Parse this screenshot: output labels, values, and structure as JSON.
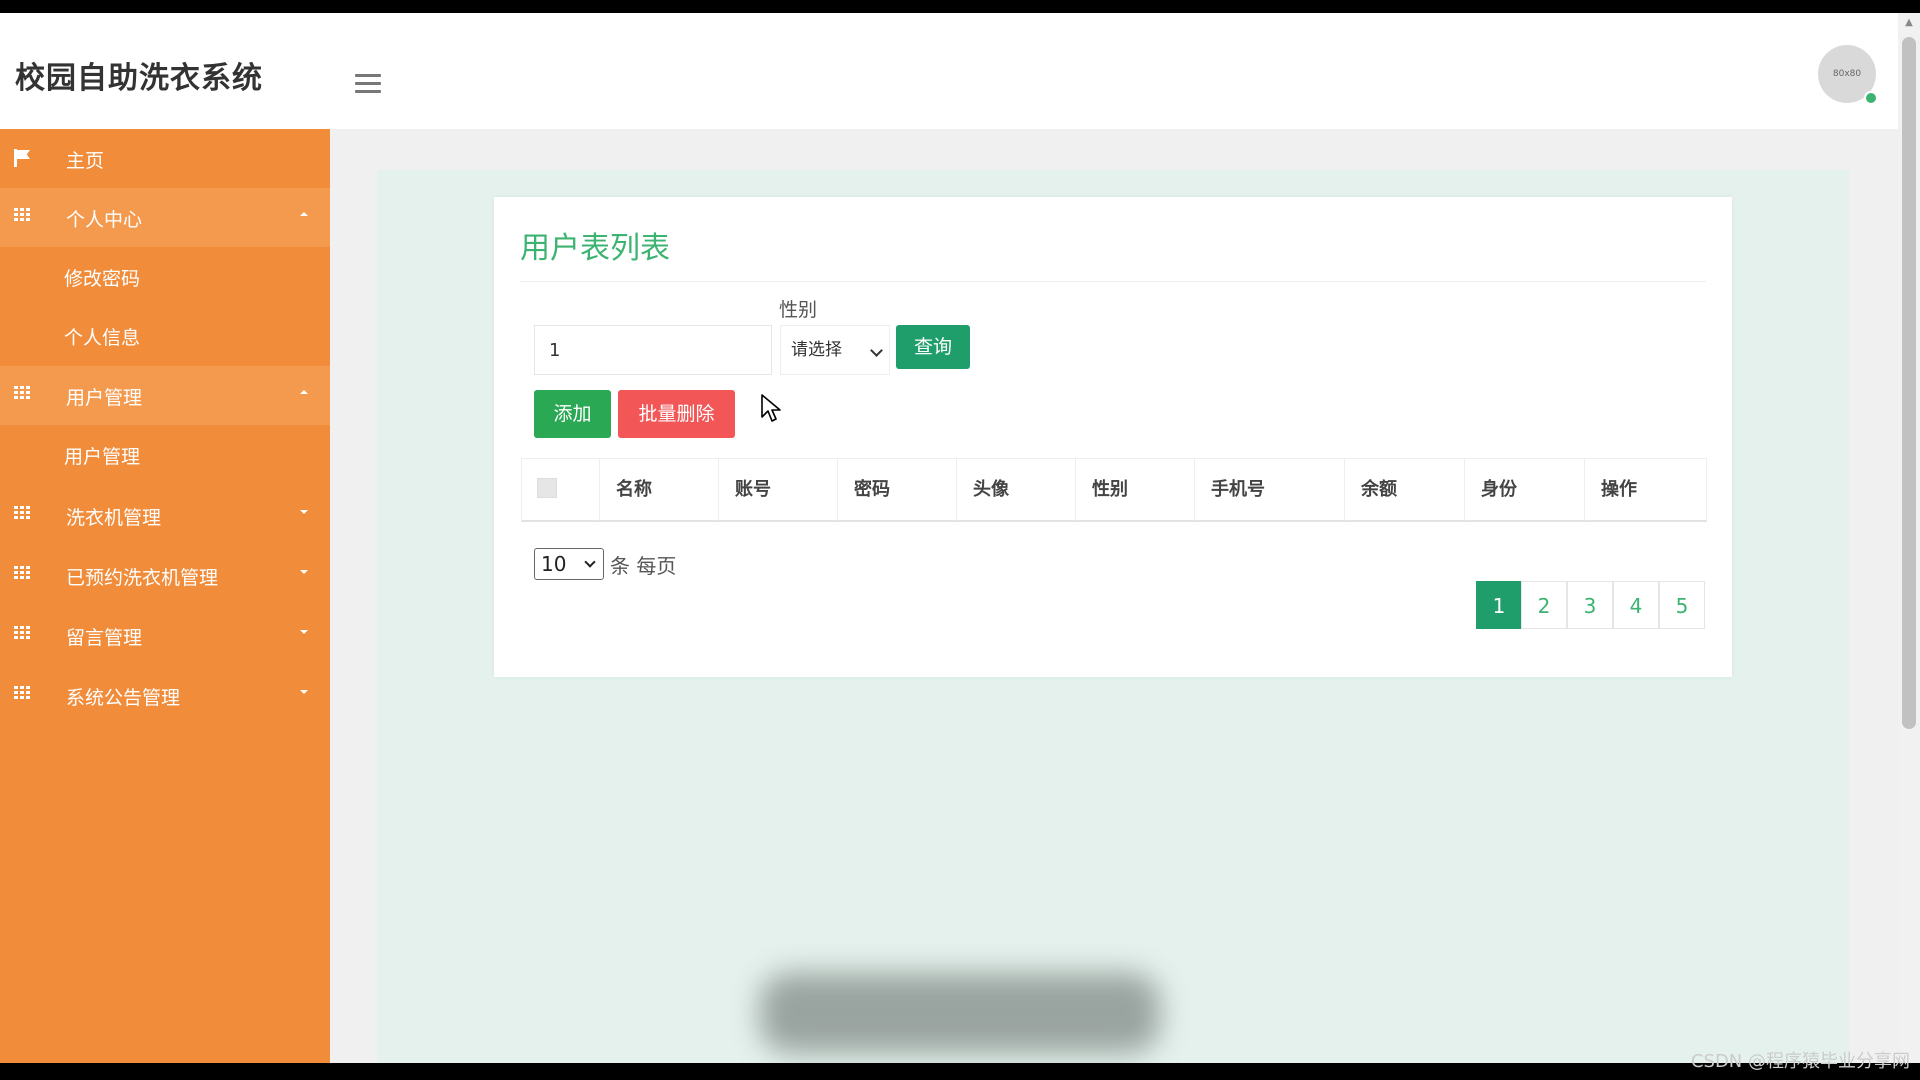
{
  "app": {
    "title": "校园自助洗衣系统",
    "avatar_text": "80x80"
  },
  "sidebar": {
    "items": [
      {
        "label": "主页",
        "type": "top"
      },
      {
        "label": "个人中心",
        "type": "group",
        "expanded": true
      },
      {
        "label": "修改密码",
        "type": "sub"
      },
      {
        "label": "个人信息",
        "type": "sub"
      },
      {
        "label": "用户管理",
        "type": "group",
        "expanded": true
      },
      {
        "label": "用户管理",
        "type": "sub"
      },
      {
        "label": "洗衣机管理",
        "type": "group",
        "expanded": false
      },
      {
        "label": "已预约洗衣机管理",
        "type": "group",
        "expanded": false
      },
      {
        "label": "留言管理",
        "type": "group",
        "expanded": false
      },
      {
        "label": "系统公告管理",
        "type": "group",
        "expanded": false
      }
    ]
  },
  "main": {
    "card_title": "用户表列表",
    "search": {
      "value": "1",
      "gender_label": "性别",
      "gender_selected": "请选择",
      "query_label": "查询"
    },
    "actions": {
      "add_label": "添加",
      "batch_delete_label": "批量删除"
    },
    "table": {
      "columns": [
        "名称",
        "账号",
        "密码",
        "头像",
        "性别",
        "手机号",
        "余额",
        "身份",
        "操作"
      ]
    },
    "pagination": {
      "page_size": "10",
      "page_size_suffix": "条 每页",
      "pages": [
        "1",
        "2",
        "3",
        "4",
        "5"
      ],
      "current": "1"
    }
  },
  "watermark": "CSDN @程序猿毕业分享网",
  "colors": {
    "sidebar": "#f08c3a",
    "accent_green": "#3cb371",
    "primary": "#1f9d6b",
    "danger": "#f25656",
    "add": "#2aa853"
  }
}
